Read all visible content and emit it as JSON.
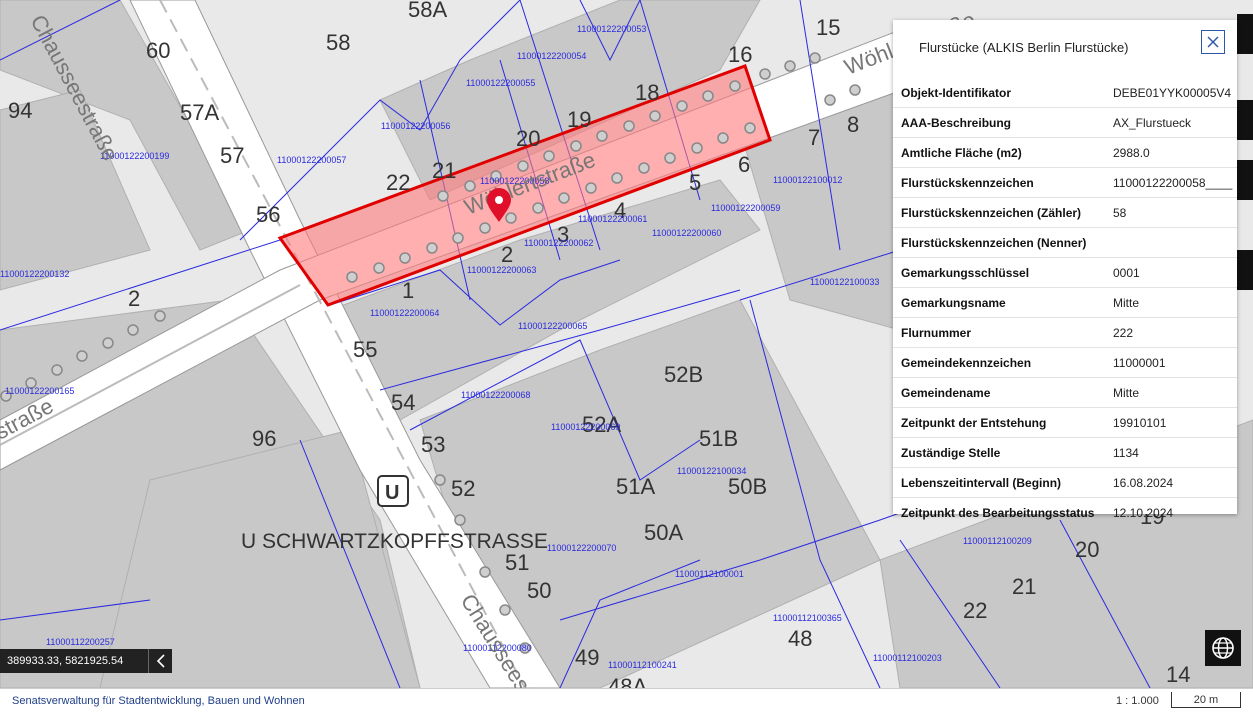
{
  "map": {
    "colors": {
      "block": "#c8c8c8",
      "street": "#ffffff",
      "parcel_line": "#2a2ae0",
      "highlight_fill": "#ff7a7a",
      "highlight_stroke": "#e00000",
      "marker": "#e0102a"
    },
    "house_numbers": [
      "58A",
      "58",
      "15",
      "60",
      "16",
      "94",
      "57A",
      "18",
      "19",
      "20",
      "57",
      "21",
      "22",
      "8",
      "7",
      "6",
      "5",
      "4",
      "3",
      "2",
      "1",
      "56",
      "55",
      "54",
      "53",
      "52",
      "52B",
      "52A",
      "51B",
      "51A",
      "50B",
      "50A",
      "51",
      "50",
      "49",
      "48",
      "96",
      "22",
      "21",
      "20",
      "19",
      "14",
      "48A"
    ],
    "parcel_ids": [
      "11000122200053",
      "11000122200054",
      "11000122200055",
      "11000122200056",
      "11000122200057",
      "11000122200199",
      "11000122200058",
      "11000122200061",
      "11000122200062",
      "11000122200063",
      "11000122200064",
      "11000122200065",
      "11000122200059",
      "11000122200060",
      "11000122100012",
      "11000122100033",
      "11000122200132",
      "11000122200165",
      "11000122200068",
      "11000122200069",
      "11000122100034",
      "11000122200070",
      "11000112100001",
      "11000112100365",
      "11000112100209",
      "11000112100203",
      "11000112200257",
      "11000112200080",
      "11000112100241"
    ],
    "street_names": [
      "Chausseestraße",
      "Wöhlertstraße",
      "Wöhlertstraße",
      "Chausseestraße",
      "straße"
    ],
    "station_name": "U SCHWARTZKOPFFSTRASSE",
    "station_icon": "u-bahn-icon",
    "marker_icon": "location-pin-icon"
  },
  "popup": {
    "title": "Flurstücke (ALKIS Berlin Flurstücke)",
    "close_icon": "close-icon",
    "rows": [
      {
        "key": "Objekt-Identifikator",
        "value": "DEBE01YYK00005V4"
      },
      {
        "key": "AAA-Beschreibung",
        "value": "AX_Flurstueck"
      },
      {
        "key": "Amtliche Fläche (m2)",
        "value": "2988.0"
      },
      {
        "key": "Flurstückskennzeichen",
        "value": "11000122200058____"
      },
      {
        "key": "Flurstückskennzeichen (Zähler)",
        "value": "58"
      },
      {
        "key": "Flurstückskennzeichen (Nenner)",
        "value": ""
      },
      {
        "key": "Gemarkungsschlüssel",
        "value": "0001"
      },
      {
        "key": "Gemarkungsname",
        "value": "Mitte"
      },
      {
        "key": "Flurnummer",
        "value": "222"
      },
      {
        "key": "Gemeindekennzeichen",
        "value": "11000001"
      },
      {
        "key": "Gemeindename",
        "value": "Mitte"
      },
      {
        "key": "Zeitpunkt der Entstehung",
        "value": "19910101"
      },
      {
        "key": "Zuständige Stelle",
        "value": "1134"
      },
      {
        "key": "Lebenszeitintervall (Beginn)",
        "value": "16.08.2024"
      },
      {
        "key": "Zeitpunkt des Bearbeitungsstatus",
        "value": "12.10.2024"
      }
    ]
  },
  "coordinates": "389933.33, 5821925.54",
  "coord_toggle_icon": "chevron-left-icon",
  "globe_icon": "globe-icon",
  "footer": {
    "attribution": "Senatsverwaltung für Stadtentwicklung, Bauen und Wohnen",
    "scale": "1 : 1.000",
    "scalebar": "20 m"
  }
}
